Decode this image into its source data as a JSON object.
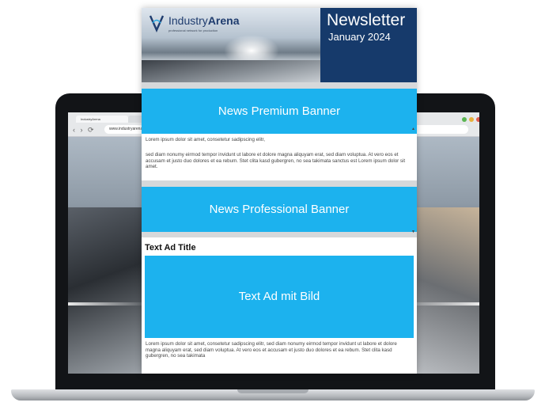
{
  "browser": {
    "tab_label": "IndustryArena",
    "url": "www.industryarena.com"
  },
  "newsletter": {
    "logo_brand_regular": "Industry",
    "logo_brand_bold": "Arena",
    "logo_tagline": "professional network for production",
    "title": "Newsletter",
    "date": "January 2024",
    "premium_banner": "News Premium Banner",
    "paragraph_short": "Lorem ipsum dolor sit amet, consetetur sadipscing elitr,",
    "paragraph_long": "sed diam nonumy eirmod tempor invidunt ut labore et dolore magna aliquyam erat, sed diam voluptua. At vero eos et accusam et justo duo dolores et ea rebum. Stet clita kasd gubergren, no sea takimata sanctus est Lorem ipsum dolor sit amet.",
    "professional_banner": "News Professional Banner",
    "text_ad_title": "Text Ad Title",
    "text_ad_image_label": "Text Ad mit Bild",
    "text_ad_body": "Lorem ipsum dolor sit amet, consetetur sadipscing elitr, sed diam nonumy eirmod tempor invidunt ut labore et dolore magna aliquyam erat, sed diam voluptua. At vero eos et accusam et justo duo dolores et ea rebum. Stet clita kasd gubergren, no sea takimata"
  },
  "colors": {
    "banner_blue": "#1cb2ee",
    "header_navy": "#163a6b"
  }
}
